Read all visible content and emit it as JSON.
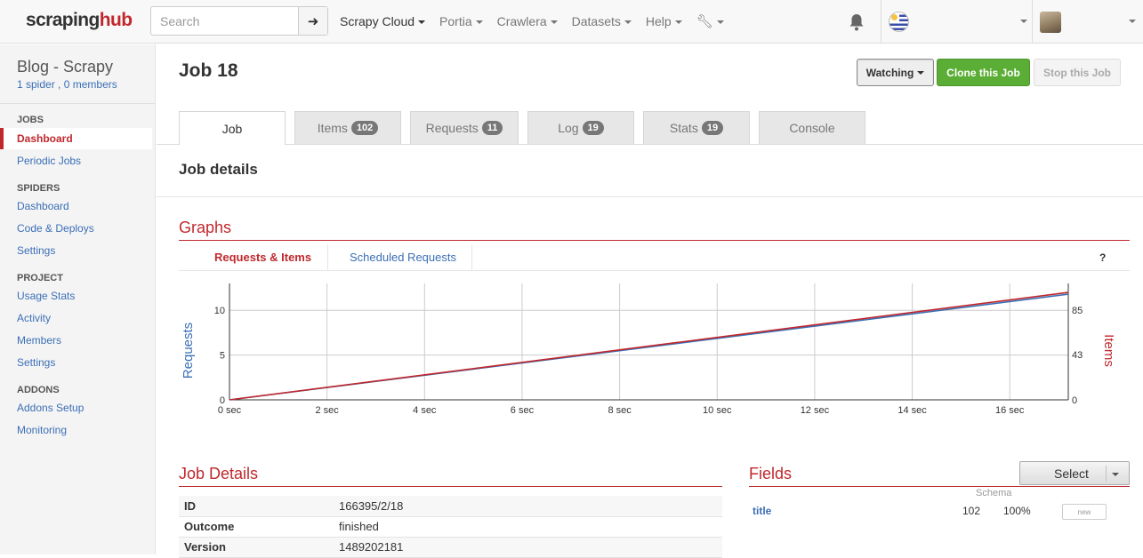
{
  "topnav": {
    "logo_main": "scraping",
    "logo_accent": "hub",
    "search_placeholder": "Search",
    "search_button_icon": "arrow-right-icon",
    "menu": [
      {
        "label": "Scrapy Cloud",
        "active": true
      },
      {
        "label": "Portia",
        "active": false
      },
      {
        "label": "Crawlera",
        "active": false
      },
      {
        "label": "Datasets",
        "active": false
      },
      {
        "label": "Help",
        "active": false
      }
    ],
    "tools_icon": "wrench-icon",
    "notifications_icon": "bell-icon",
    "org_icon": "uruguay-flag-icon"
  },
  "sidebar": {
    "project_title": "Blog - Scrapy",
    "spiders_count": "1 spider",
    "separator": ",",
    "members_count": "0 members",
    "sections": [
      {
        "heading": "JOBS",
        "items": [
          "Dashboard",
          "Periodic Jobs"
        ]
      },
      {
        "heading": "SPIDERS",
        "items": [
          "Dashboard",
          "Code & Deploys",
          "Settings"
        ]
      },
      {
        "heading": "PROJECT",
        "items": [
          "Usage Stats",
          "Activity",
          "Members",
          "Settings"
        ]
      },
      {
        "heading": "ADDONS",
        "items": [
          "Addons Setup",
          "Monitoring"
        ]
      }
    ],
    "active_item": "Dashboard"
  },
  "job": {
    "title": "Job 18",
    "buttons": {
      "watching": "Watching",
      "clone": "Clone this Job",
      "stop": "Stop this Job"
    },
    "tabs": [
      {
        "label": "Job",
        "badge": ""
      },
      {
        "label": "Items",
        "badge": "102"
      },
      {
        "label": "Requests",
        "badge": "11"
      },
      {
        "label": "Log",
        "badge": "19"
      },
      {
        "label": "Stats",
        "badge": "19"
      },
      {
        "label": "Console",
        "badge": ""
      }
    ],
    "details_heading": "Job details"
  },
  "graphs": {
    "title": "Graphs",
    "subtabs": {
      "requests_items": "Requests & Items",
      "scheduled": "Scheduled Requests"
    },
    "help": "?"
  },
  "chart_data": {
    "type": "line",
    "x": [
      0,
      17.2
    ],
    "x_ticks": [
      "0 sec",
      "2 sec",
      "4 sec",
      "6 sec",
      "8 sec",
      "10 sec",
      "12 sec",
      "14 sec",
      "16 sec"
    ],
    "x_tick_values": [
      0,
      2,
      4,
      6,
      8,
      10,
      12,
      14,
      16
    ],
    "xlim": [
      0,
      17.2
    ],
    "ylabel_left": "Requests",
    "ylabel_right": "Items",
    "y_left_ticks": [
      "0",
      "5",
      "10"
    ],
    "y_left_tick_values": [
      0,
      5,
      10
    ],
    "ylim_left": [
      0,
      13
    ],
    "y_right_ticks": [
      "0",
      "43",
      "85"
    ],
    "y_right_tick_values": [
      0,
      43,
      85
    ],
    "series": [
      {
        "axis": "left",
        "values": [
          0,
          11.8
        ],
        "color": "#3b6fb6"
      },
      {
        "axis": "right",
        "values": [
          0,
          102
        ],
        "color": "#c0282d"
      }
    ],
    "grid": true
  },
  "job_details": {
    "title": "Job Details",
    "rows": [
      {
        "key": "ID",
        "value": "166395/2/18"
      },
      {
        "key": "Outcome",
        "value": "finished"
      },
      {
        "key": "Version",
        "value": "1489202181"
      }
    ]
  },
  "fields": {
    "title": "Fields",
    "select_label": "Select",
    "schema_label": "Schema",
    "rows": [
      {
        "name": "title",
        "count": "102",
        "percent": "100%",
        "action": "new"
      }
    ]
  },
  "colors": {
    "accent": "#c0282d",
    "link": "#3b6fb6",
    "clone_green": "#5bae35"
  }
}
